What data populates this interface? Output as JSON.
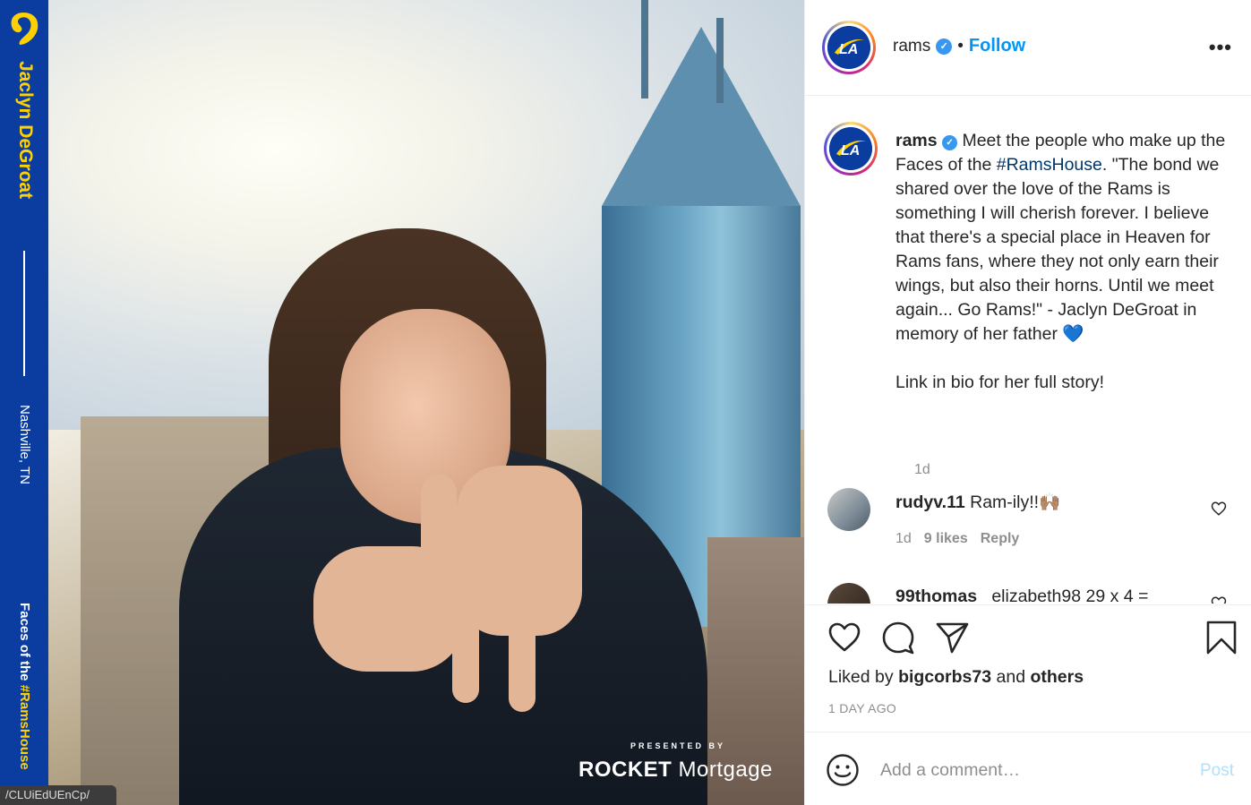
{
  "image": {
    "strip_name": "Jaclyn DeGroat",
    "strip_city": "Nashville, TN",
    "strip_faces_prefix": "Faces of the ",
    "strip_faces_hashtag": "#RamsHouse",
    "sponsor_small": "PRESENTED BY",
    "sponsor_brand": "ROCKET",
    "sponsor_brand_rest": " Mortgage",
    "url_chip": "/CLUiEdUEnCp/"
  },
  "header": {
    "username": "rams",
    "separator": "•",
    "follow_label": "Follow",
    "more_icon": "more-options-icon",
    "more_label": "•••"
  },
  "caption": {
    "username": "rams",
    "text_before_hashtag": "Meet the people who make up the Faces of the ",
    "hashtag": "#RamsHouse",
    "text_after_hashtag": ". \"The bond we shared over the love of the Rams is something I will cherish forever. I believe that there's a special place in Heaven for Rams fans, where they not only earn their wings, but also their horns. Until we meet again... Go Rams!\" - Jaclyn DeGroat in memory of her father ",
    "emoji": "💙",
    "link_line": "Link in bio for her full story!",
    "time": "1d"
  },
  "comments": [
    {
      "username": "rudyv.11",
      "text": "Ram-ily!!🙌🏽",
      "time": "1d",
      "likes": "9 likes",
      "reply": "Reply"
    },
    {
      "username": "99thomas",
      "text": "_elizabeth98 29 x 4 ="
    }
  ],
  "actions": {
    "liked_by_prefix": "Liked by ",
    "liked_by_user": "bigcorbs73",
    "liked_by_mid": " and ",
    "liked_by_others": "others",
    "date": "1 DAY AGO"
  },
  "add_comment": {
    "placeholder": "Add a comment…",
    "post_label": "Post"
  },
  "colors": {
    "rams_blue": "#0b3da1",
    "rams_gold": "#ffd100",
    "link_blue": "#0095f6",
    "verified_blue": "#3897f0"
  }
}
